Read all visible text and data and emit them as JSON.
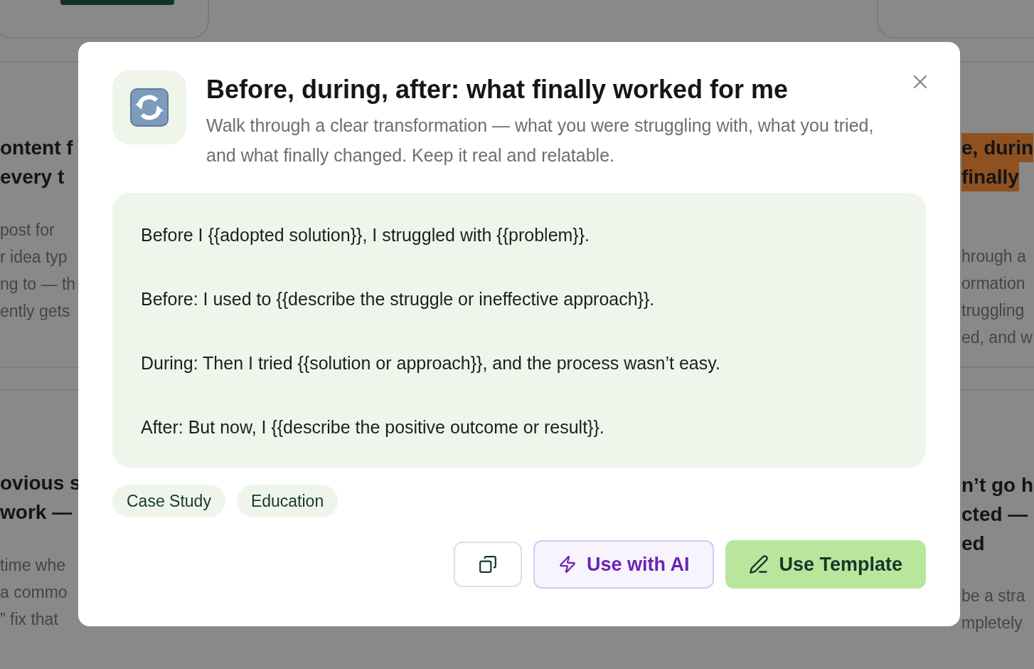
{
  "background_cards": {
    "left": [
      {
        "title_lines": [
          "ontent f",
          "every t"
        ],
        "highlighted": false,
        "description_lines": [
          "post for",
          "r idea typ",
          "ng to — th",
          "ently gets"
        ]
      },
      {
        "title_lines": [
          "ovious s",
          "work —"
        ],
        "highlighted": false,
        "description_lines": [
          "time whe",
          "a commo",
          "” fix that"
        ]
      }
    ],
    "right": [
      {
        "title_lines": [
          "e, durin",
          "finally"
        ],
        "highlighted": true,
        "description_lines": [
          "hrough a",
          "ormation",
          "truggling",
          "ed, and w"
        ]
      },
      {
        "title_lines": [
          "n’t go h",
          "cted —",
          "ed"
        ],
        "highlighted": false,
        "description_lines": [
          "be a stra",
          "mpletely"
        ]
      }
    ]
  },
  "modal": {
    "title": "Before, during, after: what finally worked for me",
    "description": "Walk through a clear transformation — what you were struggling with, what you tried, and what finally changed. Keep it real and relatable.",
    "template_lines": [
      "Before I {{adopted solution}}, I struggled with {{problem}}.",
      "Before: I used to {{describe the struggle or ineffective approach}}.",
      "During: Then I tried {{solution or approach}}, and the process wasn’t easy.",
      "After: But now, I {{describe the positive outcome or result}}."
    ],
    "tags": [
      "Case Study",
      "Education"
    ],
    "buttons": [
      {
        "kind": "copy"
      },
      {
        "kind": "ai",
        "label": "Use with AI"
      },
      {
        "kind": "primary",
        "label": "Use Template"
      }
    ]
  }
}
